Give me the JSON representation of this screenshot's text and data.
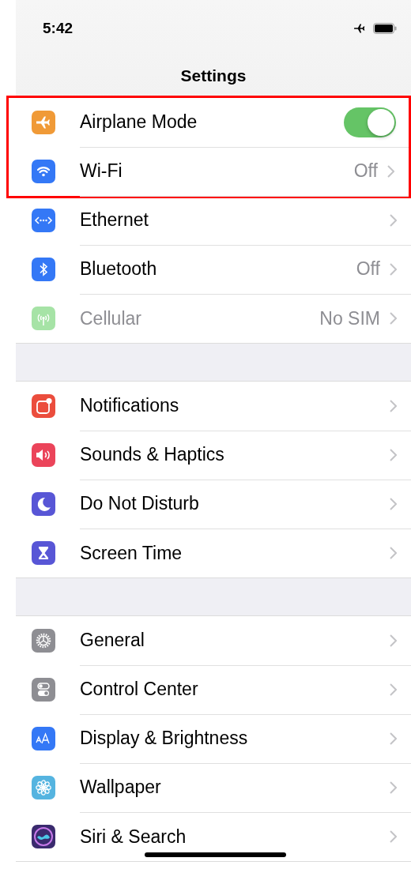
{
  "status_bar": {
    "time": "5:42"
  },
  "title": "Settings",
  "groups": [
    {
      "items": [
        {
          "kind": "toggle",
          "label": "Airplane Mode",
          "color": "#f09a37",
          "on": true,
          "highlighted": true,
          "disabled": false
        },
        {
          "kind": "link",
          "label": "Wi-Fi",
          "value": "Off",
          "color": "#3478f6",
          "highlighted": true,
          "disabled": false
        },
        {
          "kind": "link",
          "label": "Ethernet",
          "color": "#3478f6",
          "highlighted": false,
          "disabled": false
        },
        {
          "kind": "link",
          "label": "Bluetooth",
          "value": "Off",
          "color": "#3478f6",
          "highlighted": false,
          "disabled": false
        },
        {
          "kind": "link",
          "label": "Cellular",
          "value": "No SIM",
          "color": "#a6e3a6",
          "highlighted": false,
          "disabled": true
        }
      ]
    },
    {
      "items": [
        {
          "kind": "link",
          "label": "Notifications",
          "color": "#eb4d3d",
          "highlighted": false,
          "disabled": false
        },
        {
          "kind": "link",
          "label": "Sounds & Haptics",
          "color": "#eb445a",
          "highlighted": false,
          "disabled": false
        },
        {
          "kind": "link",
          "label": "Do Not Disturb",
          "color": "#5856d6",
          "highlighted": false,
          "disabled": false
        },
        {
          "kind": "link",
          "label": "Screen Time",
          "color": "#5856d6",
          "highlighted": false,
          "disabled": false
        }
      ]
    },
    {
      "items": [
        {
          "kind": "link",
          "label": "General",
          "color": "#8e8e93",
          "highlighted": false,
          "disabled": false
        },
        {
          "kind": "link",
          "label": "Control Center",
          "color": "#8e8e93",
          "highlighted": false,
          "disabled": false
        },
        {
          "kind": "link",
          "label": "Display & Brightness",
          "color": "#3478f6",
          "highlighted": false,
          "disabled": false
        },
        {
          "kind": "link",
          "label": "Wallpaper",
          "color": "#55b4e0",
          "highlighted": false,
          "disabled": false
        },
        {
          "kind": "link",
          "label": "Siri & Search",
          "color": "#3a2a6e",
          "highlighted": false,
          "disabled": false
        }
      ]
    }
  ]
}
